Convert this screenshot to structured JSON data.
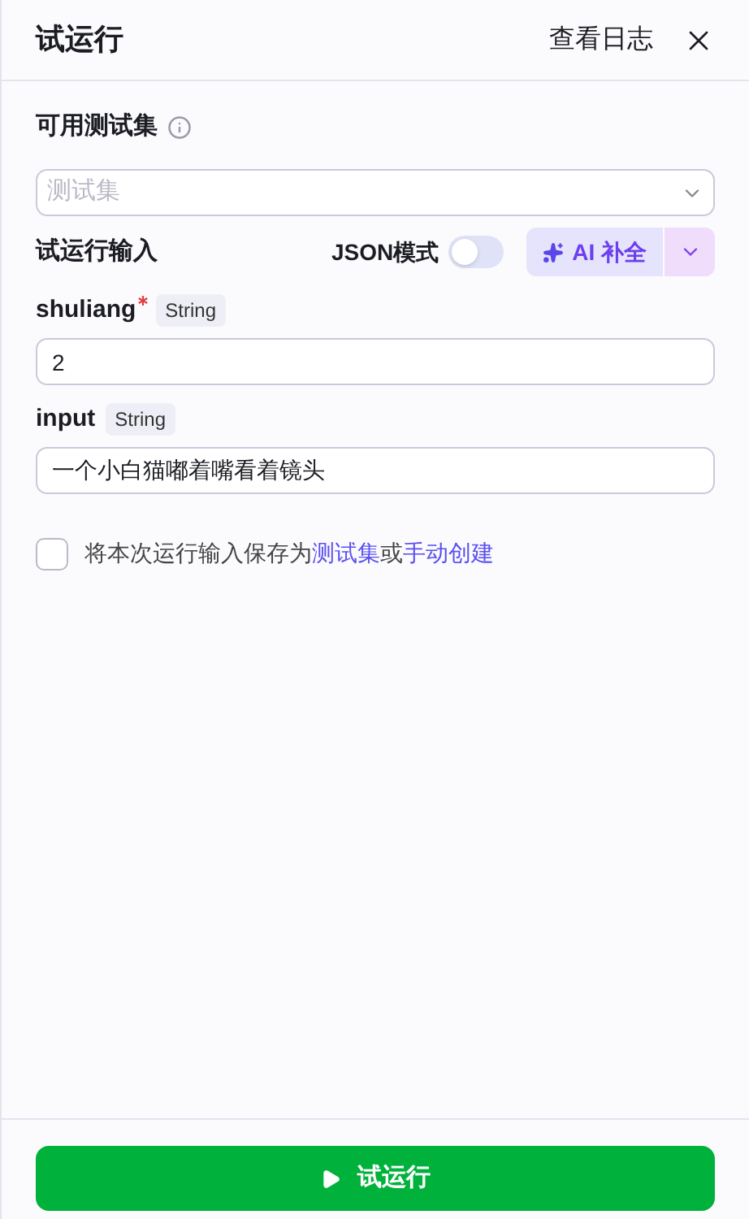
{
  "header": {
    "title": "试运行",
    "log_link": "查看日志"
  },
  "test_set": {
    "label": "可用测试集",
    "placeholder": "测试集"
  },
  "run_input": {
    "label": "试运行输入",
    "json_mode": {
      "label": "JSON模式",
      "on": false
    },
    "ai_button": "AI 补全"
  },
  "fields": [
    {
      "name": "shuliang",
      "required": true,
      "type": "String",
      "value": "2"
    },
    {
      "name": "input",
      "required": false,
      "type": "String",
      "value": "一个小白猫嘟着嘴看着镜头"
    }
  ],
  "save": {
    "checked": false,
    "text_before": "将本次运行输入保存为",
    "link_1": "测试集",
    "text_middle": "或",
    "link_2": "手动创建"
  },
  "run_button": "试运行"
}
